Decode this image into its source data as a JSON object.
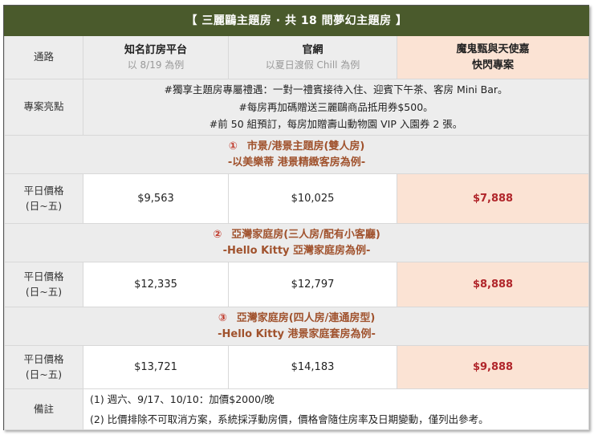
{
  "title": "【 三麗鷗主題房 · 共 18 間夢幻主題房 】",
  "header": {
    "row_label": "通路",
    "col1_title": "知名訂房平台",
    "col1_sub": "以 8/19 為例",
    "col2_title": "官網",
    "col2_sub": "以夏日渡假 Chill 為例",
    "col3_title": "魔鬼甄與天使嘉",
    "col3_sub": "快閃專案"
  },
  "features": {
    "label": "專案亮點",
    "lines": [
      "#獨享主題房專屬禮遇：一對一禮賓接待入住、迎賓下午茶、客房 Mini Bar。",
      "#每房再加碼贈送三麗鷗商品抵用券$500。",
      "#前 50 組預訂，每房加贈壽山動物園 VIP 入園券 2 張。"
    ]
  },
  "price_label_line1": "平日價格",
  "price_label_line2": "(日~五)",
  "rooms": [
    {
      "num": "①",
      "name": "市景/港景主題房(雙人房)",
      "example": "-以美樂蒂  港景精緻客房為例-",
      "prices": [
        "$9,563",
        "$10,025",
        "$7,888"
      ]
    },
    {
      "num": "②",
      "name": "亞灣家庭房(三人房/配有小客廳)",
      "example": "-Hello Kitty  亞灣家庭房為例-",
      "prices": [
        "$12,335",
        "$12,797",
        "$8,888"
      ]
    },
    {
      "num": "③",
      "name": "亞灣家庭房(四人房/連通房型)",
      "example": "-Hello Kitty  港景家庭套房為例-",
      "prices": [
        "$13,721",
        "$14,183",
        "$9,888"
      ]
    }
  ],
  "notes": {
    "label": "備註",
    "lines": [
      "(1)  週六、9/17、10/10：加價$2000/晚",
      "(2)  比價排除不可取消方案，系統採浮動房價，價格會隨住房率及日期變動，僅列出參考。"
    ]
  },
  "colors": {
    "title_bg": "#4a5a2c",
    "highlight_bg": "#fbe3d4",
    "highlight_price": "#b0252a",
    "section_text": "#a0522d"
  }
}
